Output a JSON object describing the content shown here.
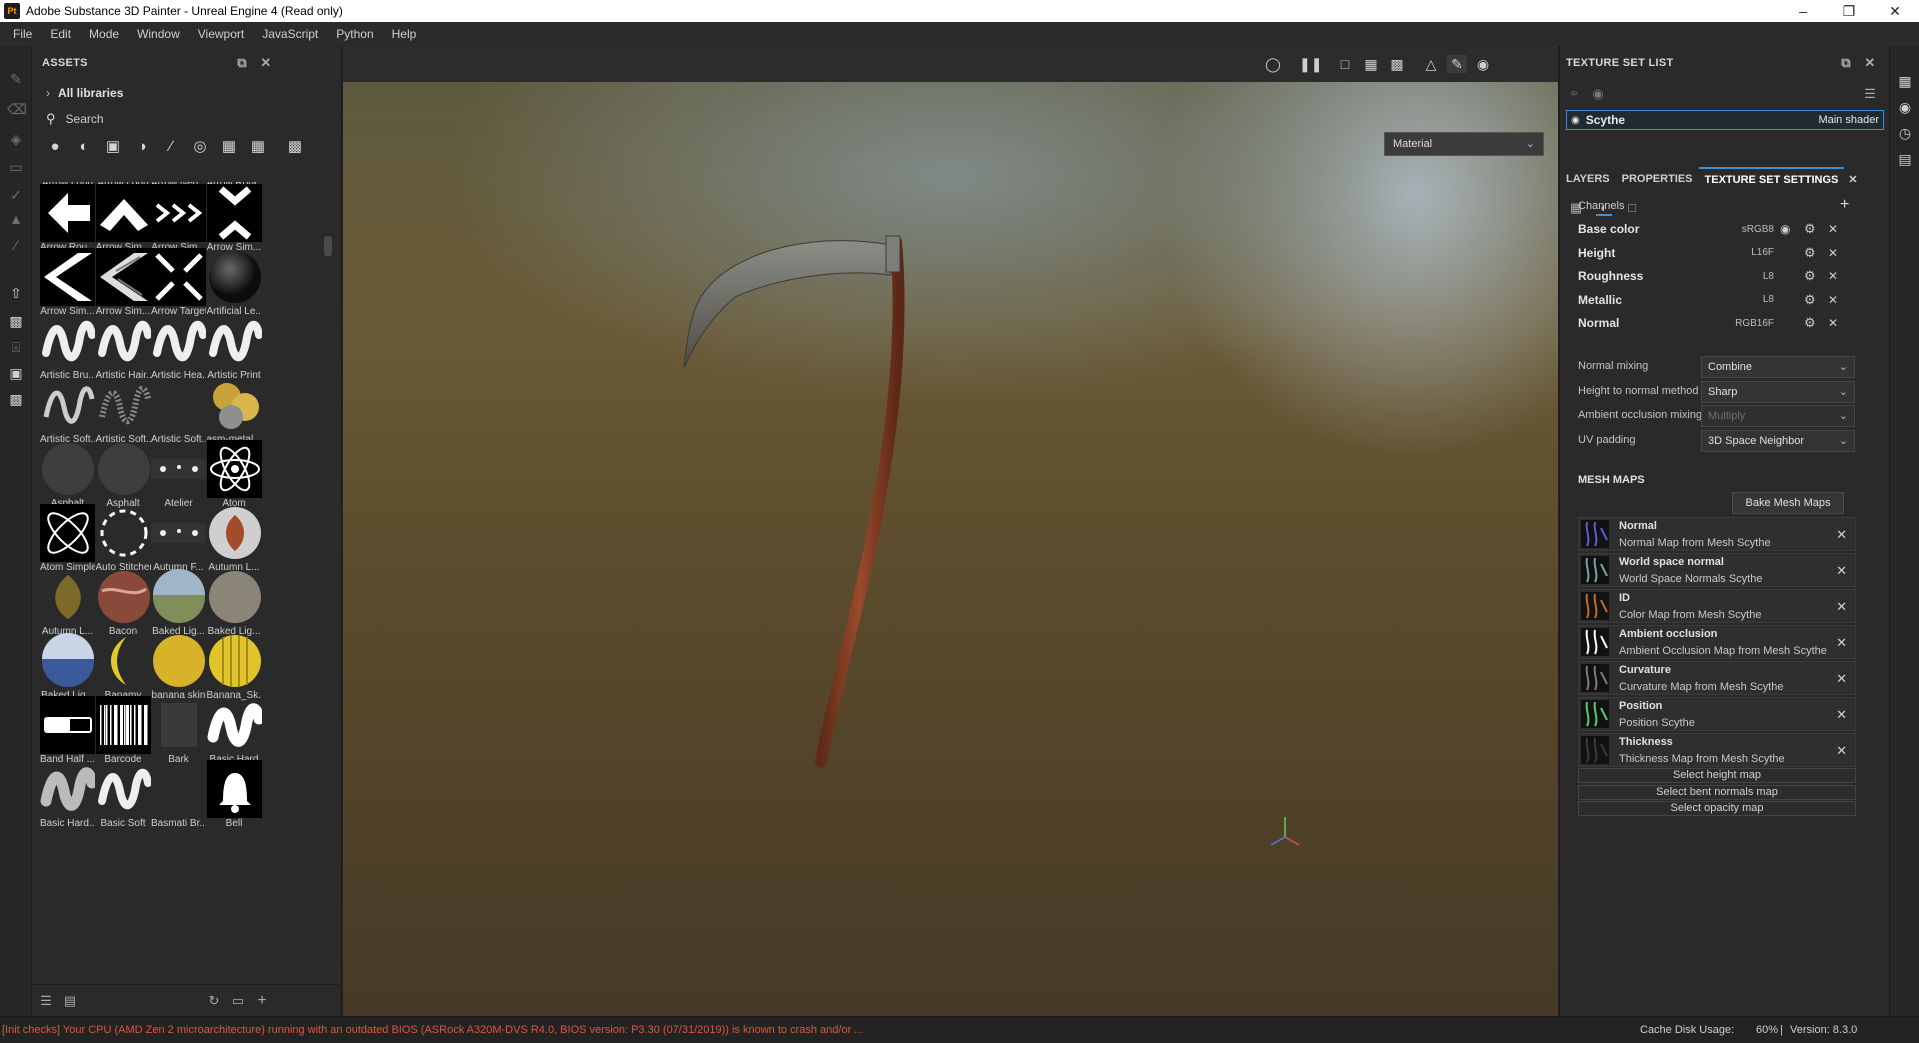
{
  "window": {
    "title": "Adobe Substance 3D Painter - Unreal Engine 4 (Read only)",
    "app_icon": "Pt"
  },
  "menu": [
    "File",
    "Edit",
    "Mode",
    "Window",
    "Viewport",
    "JavaScript",
    "Python",
    "Help"
  ],
  "assets": {
    "title": "ASSETS",
    "libraries_label": "All libraries",
    "search_placeholder": "Search",
    "items": [
      {
        "label": "Arrow Long",
        "kind": "partial"
      },
      {
        "label": "Arrow Loop",
        "kind": "partial"
      },
      {
        "label": "Arrow Neg...",
        "kind": "partial"
      },
      {
        "label": "Arrow Rota...",
        "kind": "partial"
      },
      {
        "label": "Arrow Rou...",
        "kind": "arrow-left"
      },
      {
        "label": "Arrow Sim...",
        "kind": "chevron-up"
      },
      {
        "label": "Arrow Sim...",
        "kind": "chevrons"
      },
      {
        "label": "Arrow Sim...",
        "kind": "chevron-ud"
      },
      {
        "label": "Arrow Sim...",
        "kind": "chevron-left"
      },
      {
        "label": "Arrow Sim...",
        "kind": "chevron-left-striped"
      },
      {
        "label": "Arrow Target",
        "kind": "target"
      },
      {
        "label": "Artificial Le...",
        "kind": "dark-sphere"
      },
      {
        "label": "Artistic Bru...",
        "kind": "wave"
      },
      {
        "label": "Artistic Hair...",
        "kind": "wave"
      },
      {
        "label": "Artistic Hea...",
        "kind": "wave"
      },
      {
        "label": "Artistic Print",
        "kind": "wave"
      },
      {
        "label": "Artistic Soft...",
        "kind": "wave-thin"
      },
      {
        "label": "Artistic Soft...",
        "kind": "wave-faint"
      },
      {
        "label": "Artistic Soft...",
        "kind": "blank"
      },
      {
        "label": "asm-metal...",
        "kind": "metal-balls"
      },
      {
        "label": "Asphalt",
        "kind": "asphalt"
      },
      {
        "label": "Asphalt",
        "kind": "asphalt"
      },
      {
        "label": "Atelier",
        "kind": "atelier"
      },
      {
        "label": "Atom",
        "kind": "atom"
      },
      {
        "label": "Atom Simple",
        "kind": "atom-simple"
      },
      {
        "label": "Auto Stitcher",
        "kind": "dashed-circle"
      },
      {
        "label": "Autumn F...",
        "kind": "atelier"
      },
      {
        "label": "Autumn L...",
        "kind": "leaf-sphere"
      },
      {
        "label": "Autumn L...",
        "kind": "leaf"
      },
      {
        "label": "Bacon",
        "kind": "bacon"
      },
      {
        "label": "Baked Lig...",
        "kind": "sky-sphere"
      },
      {
        "label": "Baked Lig...",
        "kind": "gray-sphere"
      },
      {
        "label": "Baked Lig...",
        "kind": "blue-sphere"
      },
      {
        "label": "Banamy",
        "kind": "banana"
      },
      {
        "label": "banana skin",
        "kind": "yellow-sphere"
      },
      {
        "label": "Banana_Sk...",
        "kind": "yellow-striped"
      },
      {
        "label": "Band Half ...",
        "kind": "band"
      },
      {
        "label": "Barcode",
        "kind": "barcode"
      },
      {
        "label": "Bark",
        "kind": "bark"
      },
      {
        "label": "Basic Hard",
        "kind": "wave-bold"
      },
      {
        "label": "Basic Hard...",
        "kind": "wave-gray"
      },
      {
        "label": "Basic Soft",
        "kind": "wave"
      },
      {
        "label": "Basmati Br...",
        "kind": "blank"
      },
      {
        "label": "Bell",
        "kind": "bell"
      }
    ]
  },
  "viewport": {
    "material_mode": "Material"
  },
  "texture_set_list": {
    "title": "TEXTURE SET LIST",
    "set_name": "Scythe",
    "shader": "Main shader"
  },
  "tabs": [
    {
      "label": "LAYERS",
      "active": false
    },
    {
      "label": "PROPERTIES",
      "active": false
    },
    {
      "label": "TEXTURE SET SETTINGS",
      "active": true
    }
  ],
  "channels": {
    "label": "Channels",
    "items": [
      {
        "name": "Base color",
        "format": "sRGB8"
      },
      {
        "name": "Height",
        "format": "L16F"
      },
      {
        "name": "Roughness",
        "format": "L8"
      },
      {
        "name": "Metallic",
        "format": "L8"
      },
      {
        "name": "Normal",
        "format": "RGB16F"
      }
    ]
  },
  "settings": [
    {
      "label": "Normal mixing",
      "value": "Combine",
      "enabled": true
    },
    {
      "label": "Height to normal method",
      "value": "Sharp",
      "enabled": true
    },
    {
      "label": "Ambient occlusion mixing",
      "value": "Multiply",
      "enabled": false
    },
    {
      "label": "UV padding",
      "value": "3D Space Neighbor",
      "enabled": true
    }
  ],
  "mesh_maps": {
    "title": "MESH MAPS",
    "bake_label": "Bake Mesh Maps",
    "items": [
      {
        "name": "Normal",
        "source": "Normal Map from Mesh Scythe",
        "color": "#5b5bd6"
      },
      {
        "name": "World space normal",
        "source": "World Space Normals Scythe",
        "color": "#7aa0a0"
      },
      {
        "name": "ID",
        "source": "Color Map from Mesh Scythe",
        "color": "#c06a2a"
      },
      {
        "name": "Ambient occlusion",
        "source": "Ambient Occlusion Map from Mesh Scythe",
        "color": "#ffffff"
      },
      {
        "name": "Curvature",
        "source": "Curvature Map from Mesh Scythe",
        "color": "#7a7a7a"
      },
      {
        "name": "Position",
        "source": "Position Scythe",
        "color": "#4fcf6a"
      },
      {
        "name": "Thickness",
        "source": "Thickness Map from Mesh Scythe",
        "color": "#3a3a3a"
      }
    ],
    "select_buttons": [
      "Select height map",
      "Select bent normals map",
      "Select opacity map"
    ]
  },
  "status": {
    "message": "[Init checks] Your CPU (AMD Zen 2 microarchitecture) running with an outdated BIOS (ASRock A320M-DVS R4.0, BIOS version: P3.30 (07/31/2019)) is known to crash and/or ...",
    "cache": "Cache Disk Usage:",
    "cache_value": "60%",
    "version": "Version: 8.3.0",
    "message_color": "#e0553a"
  }
}
